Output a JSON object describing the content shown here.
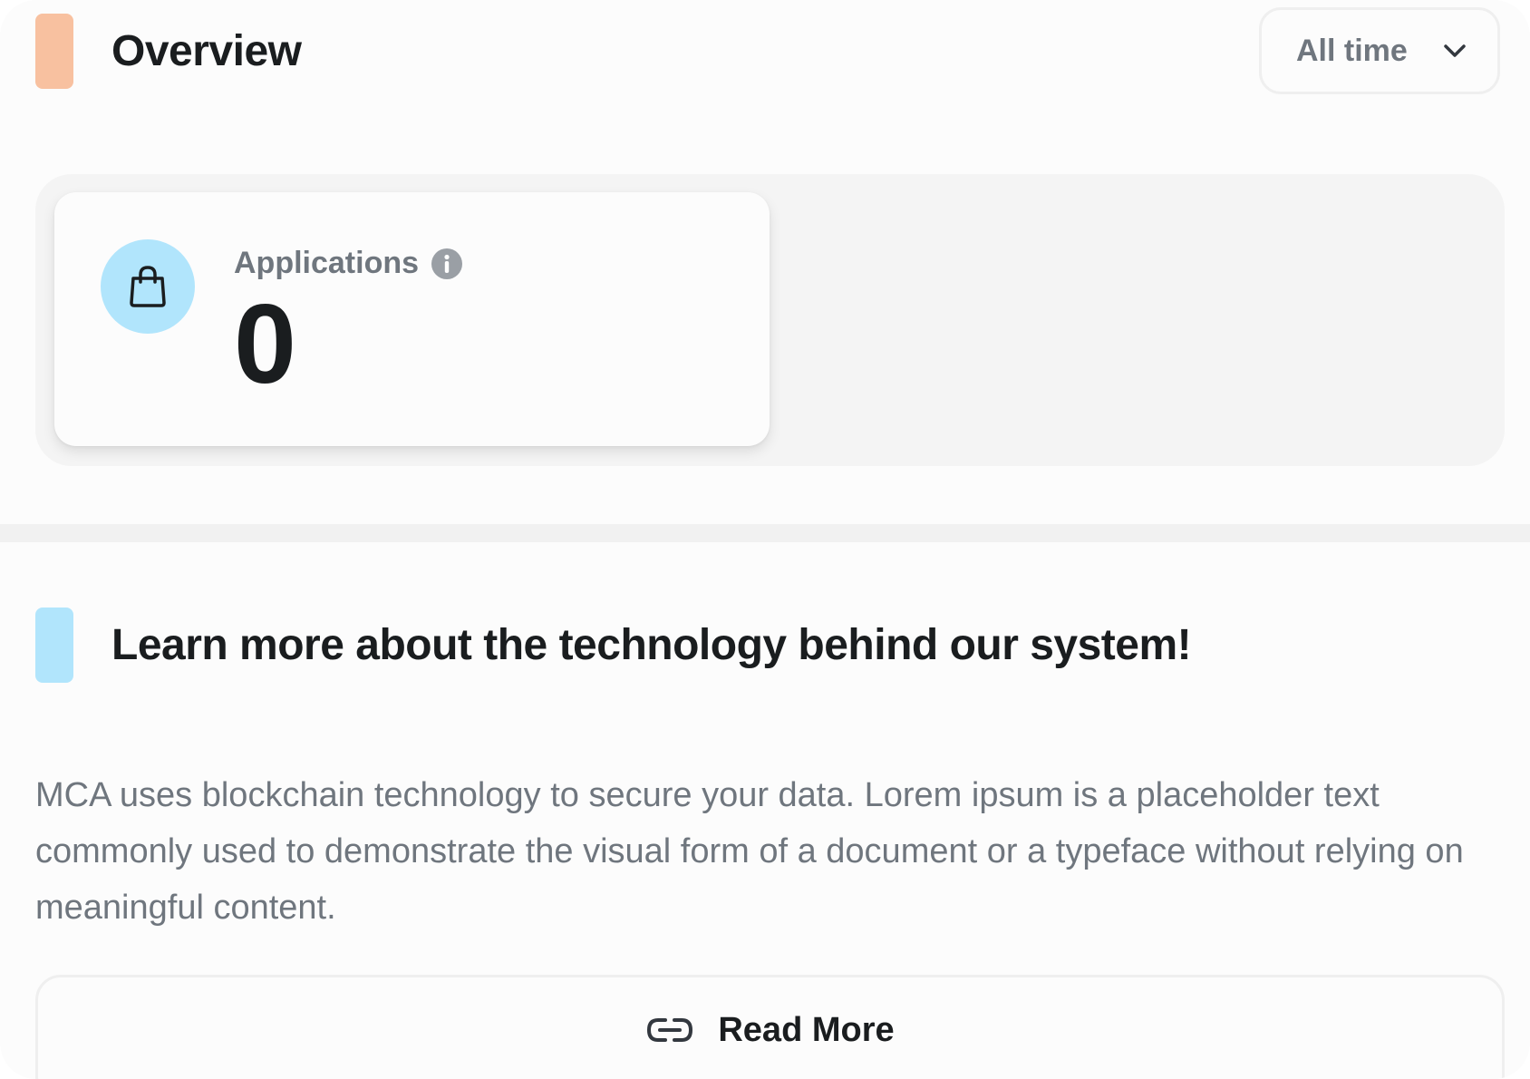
{
  "colors": {
    "accent_orange": "#f8c1a0",
    "accent_blue": "#b1e5fc",
    "text_primary": "#1a1d1f",
    "text_secondary": "#6f767e"
  },
  "overview": {
    "title": "Overview",
    "range_select": {
      "value": "All time",
      "icon": "chevron-down-icon"
    },
    "stats": [
      {
        "icon": "shopping-bag-icon",
        "label": "Applications",
        "info_icon": "info-icon",
        "value": "0"
      }
    ]
  },
  "learn_more": {
    "title": "Learn more about the technology behind our system!",
    "body": "MCA uses blockchain technology to secure your data. Lorem ipsum is a placeholder text commonly used to demonstrate the visual form of a document or a typeface without relying on meaningful content.",
    "button": {
      "label": "Read More",
      "icon": "link-icon"
    }
  }
}
